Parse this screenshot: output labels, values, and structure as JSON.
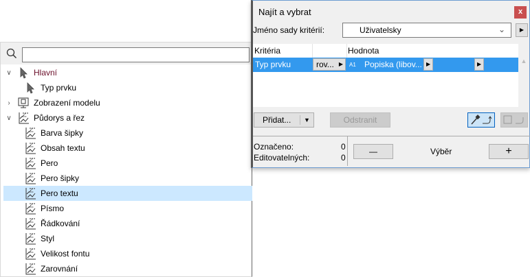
{
  "search": {
    "value": "",
    "placeholder": ""
  },
  "tree": [
    {
      "label": "Hlavní",
      "icon": "cursor-icon",
      "expanded": true,
      "level": 0,
      "color": "#6b0f2a"
    },
    {
      "label": "Typ prvku",
      "icon": "cursor-icon",
      "level": 1
    },
    {
      "label": "Zobrazení modelu",
      "icon": "model-view-icon",
      "expanded": false,
      "level": 0
    },
    {
      "label": "Půdorys a řez",
      "icon": "floorplan-icon",
      "expanded": true,
      "level": 0
    },
    {
      "label": "Barva šipky",
      "icon": "floorplan-icon",
      "level": 1
    },
    {
      "label": "Obsah textu",
      "icon": "floorplan-icon",
      "level": 1
    },
    {
      "label": "Pero",
      "icon": "floorplan-icon",
      "level": 1
    },
    {
      "label": "Pero šipky",
      "icon": "floorplan-icon",
      "level": 1
    },
    {
      "label": "Pero textu",
      "icon": "floorplan-icon",
      "level": 1,
      "selected": true
    },
    {
      "label": "Písmo",
      "icon": "floorplan-icon",
      "level": 1
    },
    {
      "label": "Řádkování",
      "icon": "floorplan-icon",
      "level": 1
    },
    {
      "label": "Styl",
      "icon": "floorplan-icon",
      "level": 1
    },
    {
      "label": "Velikost fontu",
      "icon": "floorplan-icon",
      "level": 1
    },
    {
      "label": "Zarovnání",
      "icon": "floorplan-icon",
      "level": 1
    }
  ],
  "dialog": {
    "title": "Najít a vybrat",
    "close": "x",
    "criteria_set_label": "Jméno sady kritérií:",
    "criteria_set_value": "Uživatelsky",
    "table": {
      "headers": [
        "Kritéria",
        "",
        "Hodnota"
      ],
      "rows": [
        {
          "criterion": "Typ prvku",
          "operator": "rov...",
          "value_icon": "label-icon",
          "value_icon_text": "A1",
          "value": "Popiska (libov..."
        }
      ]
    },
    "add": "Přidat...",
    "remove": "Odstranit",
    "selected_label": "Označeno:",
    "selected_count": "0",
    "editable_label": "Editovatelných:",
    "editable_count": "0",
    "minus": "—",
    "selection": "Výběr",
    "plus": "+",
    "accent": "#3399ee"
  }
}
